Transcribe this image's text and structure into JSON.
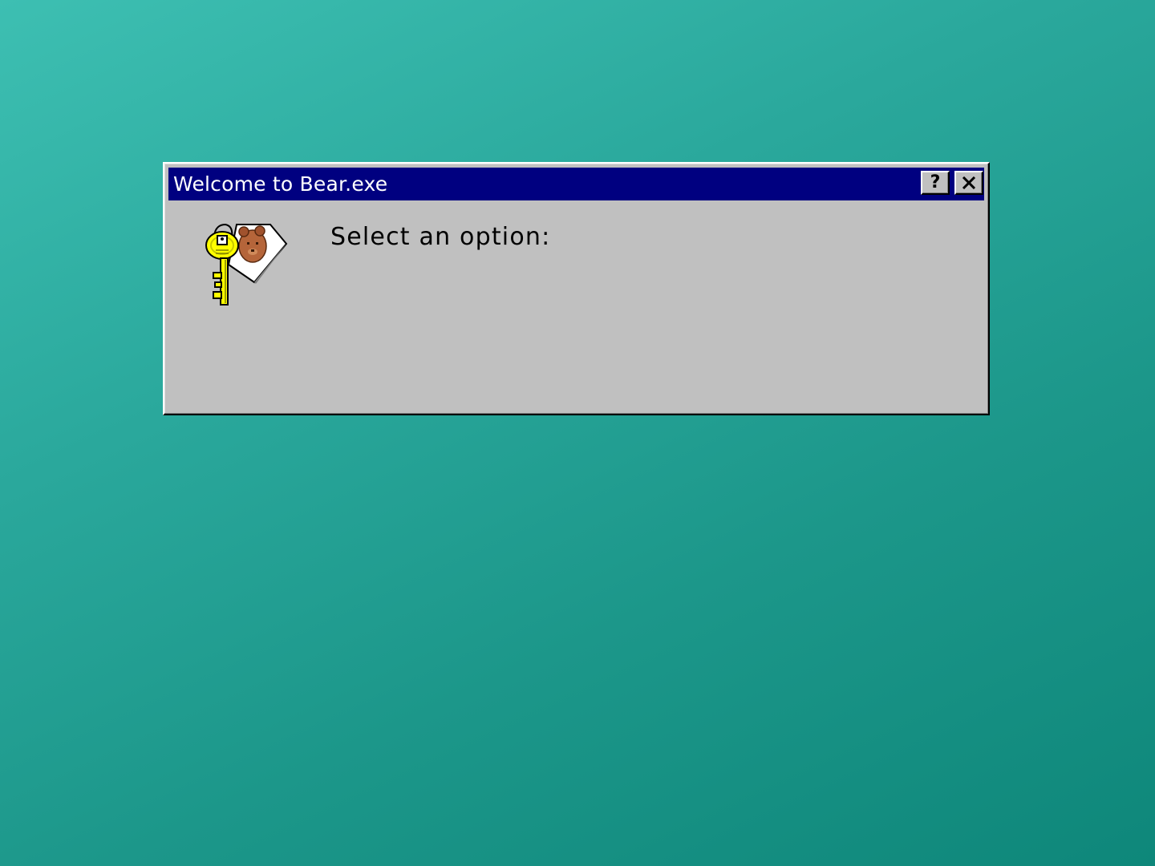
{
  "window": {
    "title": "Welcome to Bear.exe",
    "help_button_label": "?",
    "close_icon": "close-icon"
  },
  "dialog": {
    "prompt": "Select an option:",
    "icon": "key-with-bear-tag-icon"
  },
  "colors": {
    "desktop": "#2aa89c",
    "titlebar": "#000080",
    "window_face": "#c0c0c0",
    "key_yellow": "#ffff00",
    "bear_brown": "#a0522d"
  }
}
